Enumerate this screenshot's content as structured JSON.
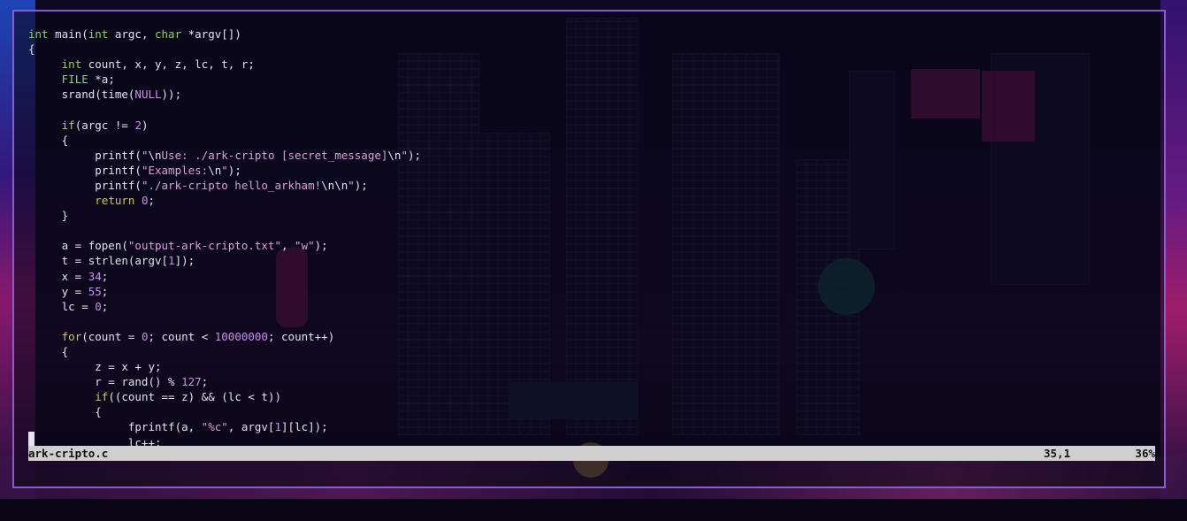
{
  "editor": {
    "lines": [
      [
        {
          "t": "int",
          "c": "ty"
        },
        {
          "t": " main(",
          "c": ""
        },
        {
          "t": "int",
          "c": "ty"
        },
        {
          "t": " argc, ",
          "c": ""
        },
        {
          "t": "char",
          "c": "ty"
        },
        {
          "t": " *argv[])",
          "c": ""
        }
      ],
      [
        {
          "t": "{",
          "c": ""
        }
      ],
      [
        {
          "t": "     ",
          "c": ""
        },
        {
          "t": "int",
          "c": "ty"
        },
        {
          "t": " count, x, y, z, lc, t, r;",
          "c": ""
        }
      ],
      [
        {
          "t": "     ",
          "c": ""
        },
        {
          "t": "FILE",
          "c": "ty"
        },
        {
          "t": " *a;",
          "c": ""
        }
      ],
      [
        {
          "t": "     srand(time(",
          "c": ""
        },
        {
          "t": "NULL",
          "c": "num"
        },
        {
          "t": "));",
          "c": ""
        }
      ],
      [
        {
          "t": "",
          "c": ""
        }
      ],
      [
        {
          "t": "     ",
          "c": ""
        },
        {
          "t": "if",
          "c": "kw"
        },
        {
          "t": "(argc != ",
          "c": ""
        },
        {
          "t": "2",
          "c": "num"
        },
        {
          "t": ")",
          "c": ""
        }
      ],
      [
        {
          "t": "     {",
          "c": ""
        }
      ],
      [
        {
          "t": "          printf(",
          "c": ""
        },
        {
          "t": "\"",
          "c": "str"
        },
        {
          "t": "\\n",
          "c": ""
        },
        {
          "t": "Use: ./ark-cripto [secret_message]",
          "c": "str"
        },
        {
          "t": "\\n",
          "c": ""
        },
        {
          "t": "\"",
          "c": "str"
        },
        {
          "t": ");",
          "c": ""
        }
      ],
      [
        {
          "t": "          printf(",
          "c": ""
        },
        {
          "t": "\"Examples:",
          "c": "str"
        },
        {
          "t": "\\n",
          "c": ""
        },
        {
          "t": "\"",
          "c": "str"
        },
        {
          "t": ");",
          "c": ""
        }
      ],
      [
        {
          "t": "          printf(",
          "c": ""
        },
        {
          "t": "\"./ark-cripto hello_arkham!",
          "c": "str"
        },
        {
          "t": "\\n\\n",
          "c": ""
        },
        {
          "t": "\"",
          "c": "str"
        },
        {
          "t": ");",
          "c": ""
        }
      ],
      [
        {
          "t": "          ",
          "c": ""
        },
        {
          "t": "return",
          "c": "kw"
        },
        {
          "t": " ",
          "c": ""
        },
        {
          "t": "0",
          "c": "num"
        },
        {
          "t": ";",
          "c": ""
        }
      ],
      [
        {
          "t": "     }",
          "c": ""
        }
      ],
      [
        {
          "t": "",
          "c": ""
        }
      ],
      [
        {
          "t": "     a = fopen(",
          "c": ""
        },
        {
          "t": "\"output-ark-cripto.txt\"",
          "c": "str"
        },
        {
          "t": ", ",
          "c": ""
        },
        {
          "t": "\"w\"",
          "c": "str"
        },
        {
          "t": ");",
          "c": ""
        }
      ],
      [
        {
          "t": "     t = strlen(argv[",
          "c": ""
        },
        {
          "t": "1",
          "c": "num"
        },
        {
          "t": "]);",
          "c": ""
        }
      ],
      [
        {
          "t": "     x = ",
          "c": ""
        },
        {
          "t": "34",
          "c": "num"
        },
        {
          "t": ";",
          "c": ""
        }
      ],
      [
        {
          "t": "     y = ",
          "c": ""
        },
        {
          "t": "55",
          "c": "num"
        },
        {
          "t": ";",
          "c": ""
        }
      ],
      [
        {
          "t": "     lc = ",
          "c": ""
        },
        {
          "t": "0",
          "c": "num"
        },
        {
          "t": ";",
          "c": ""
        }
      ],
      [
        {
          "t": "",
          "c": ""
        }
      ],
      [
        {
          "t": "     ",
          "c": ""
        },
        {
          "t": "for",
          "c": "kw"
        },
        {
          "t": "(count = ",
          "c": ""
        },
        {
          "t": "0",
          "c": "num"
        },
        {
          "t": "; count < ",
          "c": ""
        },
        {
          "t": "10000000",
          "c": "num"
        },
        {
          "t": "; count++)",
          "c": ""
        }
      ],
      [
        {
          "t": "     {",
          "c": ""
        }
      ],
      [
        {
          "t": "          z = x + y;",
          "c": ""
        }
      ],
      [
        {
          "t": "          r = rand() % ",
          "c": ""
        },
        {
          "t": "127",
          "c": "num"
        },
        {
          "t": ";",
          "c": ""
        }
      ],
      [
        {
          "t": "          ",
          "c": ""
        },
        {
          "t": "if",
          "c": "kw"
        },
        {
          "t": "((count == z) && (lc < t))",
          "c": ""
        }
      ],
      [
        {
          "t": "          {",
          "c": ""
        }
      ],
      [
        {
          "t": "               fprintf(a, ",
          "c": ""
        },
        {
          "t": "\"%c\"",
          "c": "str"
        },
        {
          "t": ", argv[",
          "c": ""
        },
        {
          "t": "1",
          "c": "num"
        },
        {
          "t": "][lc]);",
          "c": ""
        }
      ],
      [
        {
          "t": "               lc++;",
          "c": ""
        }
      ]
    ]
  },
  "statusbar": {
    "filename": "ark-cripto.c",
    "position": "35,1",
    "percent": "36%"
  }
}
